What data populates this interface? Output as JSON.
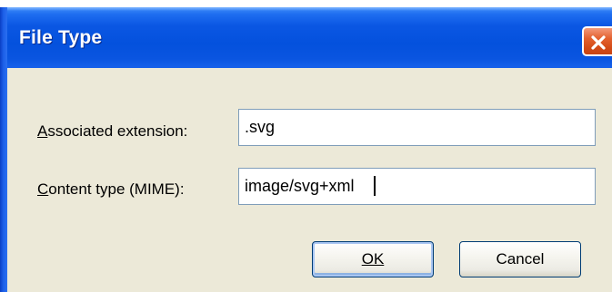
{
  "dialog": {
    "title": "File Type",
    "close_icon": "close-icon"
  },
  "fields": {
    "extension": {
      "label_mnemonic": "A",
      "label_rest": "ssociated extension:",
      "value": ".svg"
    },
    "mime": {
      "label_mnemonic": "C",
      "label_rest": "ontent type (MIME):",
      "value": "image/svg+xml"
    }
  },
  "buttons": {
    "ok_label": "OK",
    "cancel_label": "Cancel"
  },
  "colors": {
    "title_bar": "#0451dd",
    "dialog_face": "#ece9d8",
    "close_button": "#d34a17",
    "input_border": "#7f9db9",
    "button_border": "#003c74"
  }
}
